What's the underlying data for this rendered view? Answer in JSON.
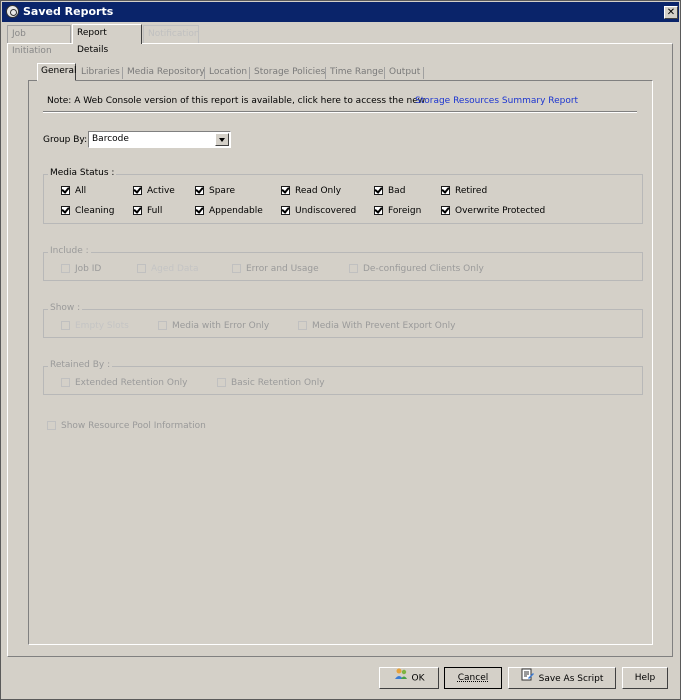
{
  "window": {
    "title": "Saved Reports"
  },
  "outer_tabs": [
    {
      "label": "Job Initiation"
    },
    {
      "label": "Report Details"
    },
    {
      "label": "Notification"
    }
  ],
  "inner_tabs": [
    {
      "label": "General"
    },
    {
      "label": "Libraries"
    },
    {
      "label": "Media Repository"
    },
    {
      "label": "Location"
    },
    {
      "label": "Storage Policies"
    },
    {
      "label": "Time Range"
    },
    {
      "label": "Output"
    }
  ],
  "note": {
    "text": "Note: A Web Console version of this report is available, click here to access the new",
    "link": "Storage Resources Summary Report"
  },
  "group_by": {
    "label": "Group By:",
    "value": "Barcode"
  },
  "media_status": {
    "label": "Media Status :",
    "items": [
      {
        "label": "All",
        "checked": true
      },
      {
        "label": "Active",
        "checked": true
      },
      {
        "label": "Spare",
        "checked": true
      },
      {
        "label": "Read Only",
        "checked": true
      },
      {
        "label": "Bad",
        "checked": true
      },
      {
        "label": "Retired",
        "checked": true
      },
      {
        "label": "Cleaning",
        "checked": true
      },
      {
        "label": "Full",
        "checked": true
      },
      {
        "label": "Appendable",
        "checked": true
      },
      {
        "label": "Undiscovered",
        "checked": true
      },
      {
        "label": "Foreign",
        "checked": true
      },
      {
        "label": "Overwrite Protected",
        "checked": true
      }
    ]
  },
  "include": {
    "label": "Include :",
    "items": [
      {
        "label": "Job ID",
        "checked": false
      },
      {
        "label": "Aged Data",
        "checked": false
      },
      {
        "label": "Error and Usage",
        "checked": false
      },
      {
        "label": "De-configured Clients Only",
        "checked": false
      }
    ]
  },
  "show": {
    "label": "Show :",
    "items": [
      {
        "label": "Empty Slots",
        "checked": false
      },
      {
        "label": "Media with Error Only",
        "checked": false
      },
      {
        "label": "Media With Prevent Export Only",
        "checked": false
      }
    ]
  },
  "retained_by": {
    "label": "Retained By :",
    "items": [
      {
        "label": "Extended Retention Only",
        "checked": false
      },
      {
        "label": "Basic Retention Only",
        "checked": false
      }
    ]
  },
  "resource_pool": {
    "label": "Show Resource Pool Information",
    "checked": false
  },
  "buttons": {
    "ok": "OK",
    "cancel": "Cancel",
    "save_script": "Save As Script",
    "help": "Help"
  }
}
